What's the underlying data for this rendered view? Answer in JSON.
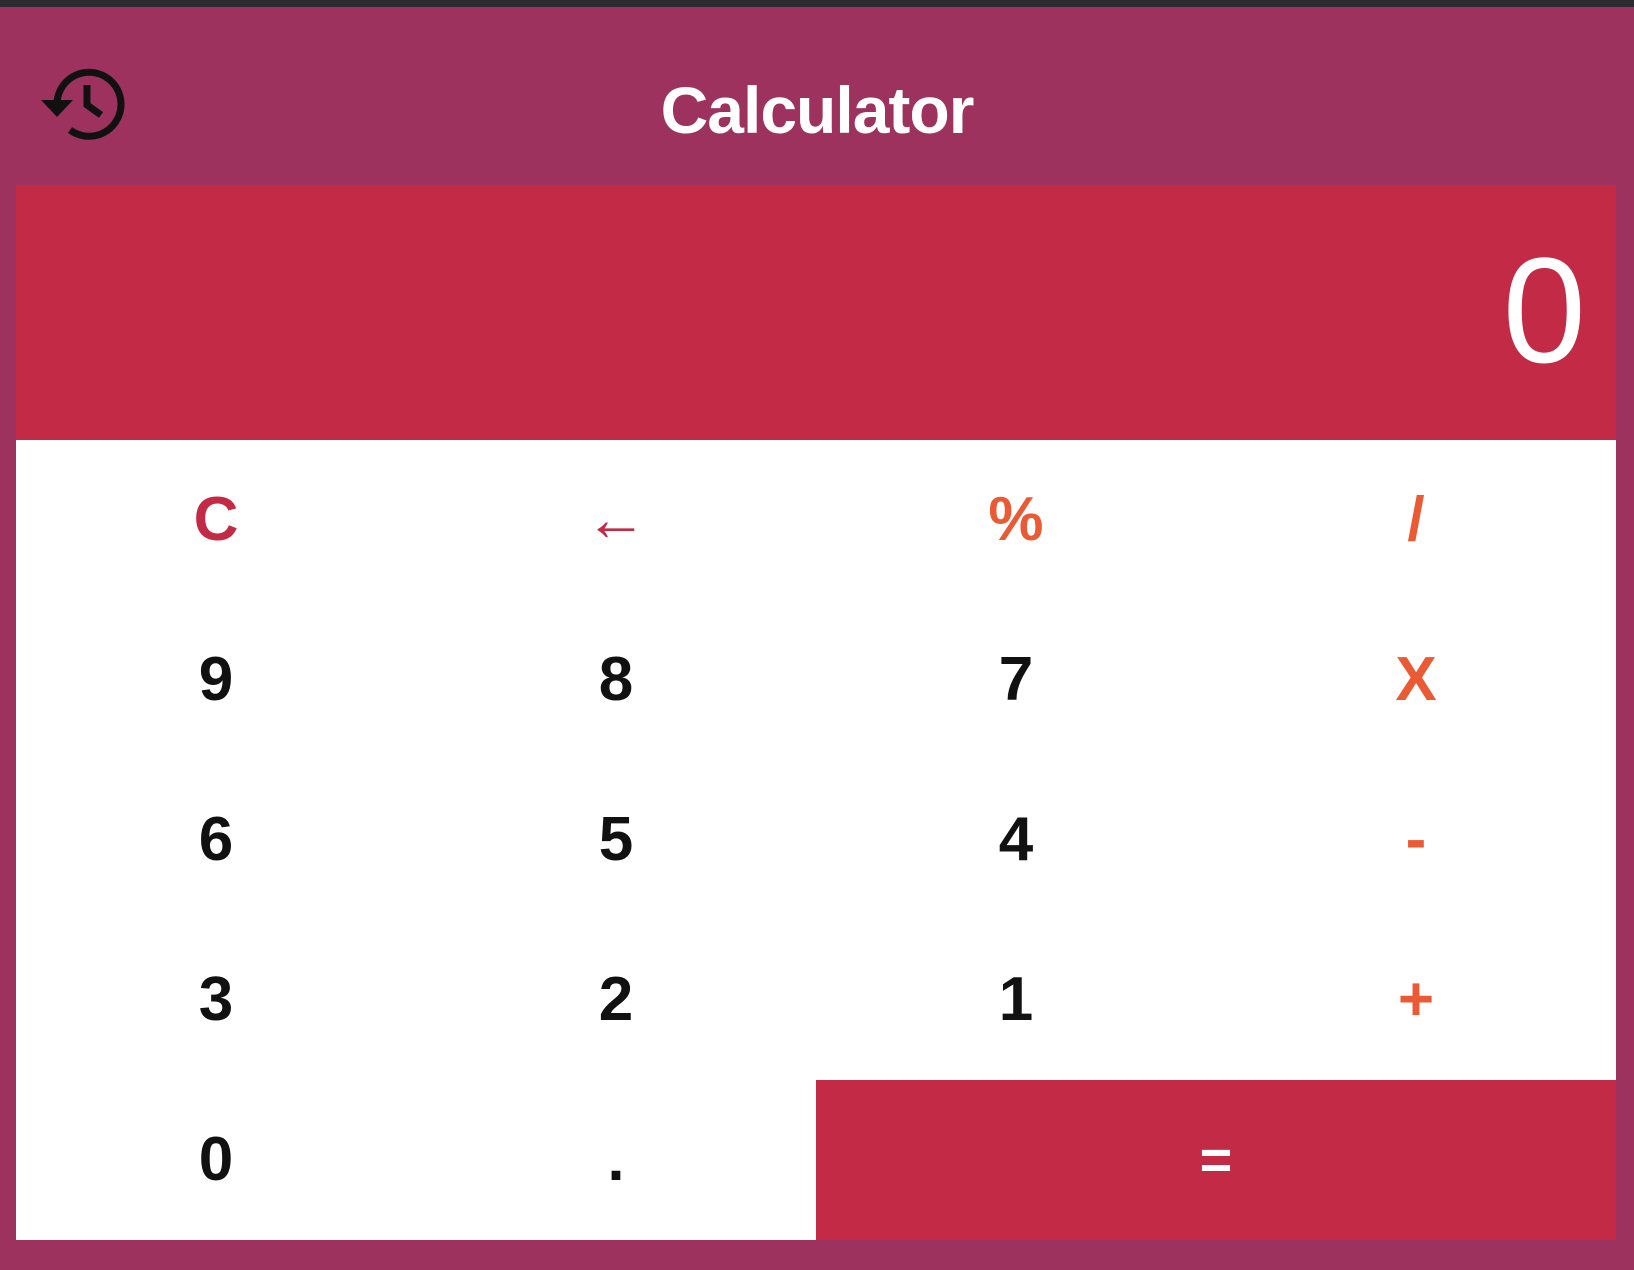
{
  "header": {
    "title": "Calculator",
    "history_icon": "history-icon"
  },
  "display": {
    "value": "0"
  },
  "keys": {
    "clear": "C",
    "backspace": "←",
    "percent": "%",
    "divide": "/",
    "nine": "9",
    "eight": "8",
    "seven": "7",
    "multiply": "X",
    "six": "6",
    "five": "5",
    "four": "4",
    "subtract": "-",
    "three": "3",
    "two": "2",
    "one": "1",
    "add": "+",
    "zero": "0",
    "decimal": ".",
    "equals": "="
  },
  "colors": {
    "window_bg": "#9c325d",
    "display_bg": "#c22a45",
    "keypad_bg": "#ffffff",
    "function_key": "#c22a45",
    "operator_key": "#ea5a35",
    "digit_key": "#111111",
    "equals_bg": "#c22a45"
  }
}
